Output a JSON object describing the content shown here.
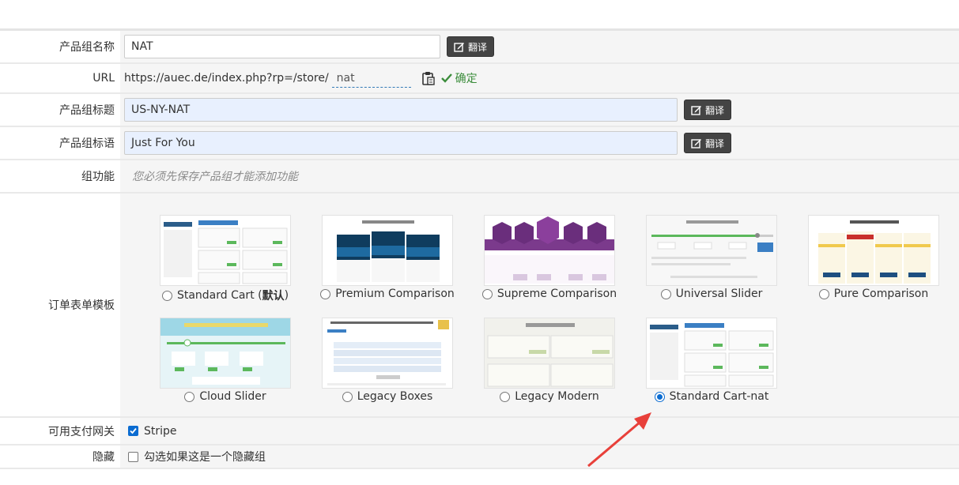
{
  "form": {
    "group_name": {
      "label": "产品组名称",
      "value": "NAT",
      "translate_label": "翻译"
    },
    "url": {
      "label": "URL",
      "prefix": "https://auec.de/index.php?rp=/store/",
      "slug": "nat",
      "confirm_label": "确定"
    },
    "group_headline": {
      "label": "产品组标题",
      "value": "US-NY-NAT",
      "translate_label": "翻译"
    },
    "group_tagline": {
      "label": "产品组标语",
      "value": "Just For You",
      "translate_label": "翻译"
    },
    "group_features": {
      "label": "组功能",
      "hint": "您必须先保存产品组才能添加功能"
    },
    "order_template": {
      "label": "订单表单模板",
      "templates": [
        {
          "name": "Standard Cart (",
          "name_bold": "默认",
          "name_end": ")",
          "selected": false
        },
        {
          "name": "Premium Comparison",
          "selected": false
        },
        {
          "name": "Supreme Comparison",
          "selected": false
        },
        {
          "name": "Universal Slider",
          "selected": false
        },
        {
          "name": "Pure Comparison",
          "selected": false
        },
        {
          "name": "Cloud Slider",
          "selected": false
        },
        {
          "name": "Legacy Boxes",
          "selected": false
        },
        {
          "name": "Legacy Modern",
          "selected": false
        },
        {
          "name": "Standard Cart-nat",
          "selected": true
        }
      ]
    },
    "payment_gateways": {
      "label": "可用支付网关",
      "option": "Stripe",
      "checked": true
    },
    "hidden": {
      "label": "隐藏",
      "option": "勾选如果这是一个隐藏组",
      "checked": false
    }
  },
  "colors": {
    "accent": "#0b6cd1",
    "translate_button": "#444444",
    "confirm": "#3c8d3c",
    "annotation_arrow": "#e8403a"
  },
  "icons": [
    "edit-icon",
    "clipboard-icon",
    "check-icon",
    "radio-icon",
    "checkbox-icon",
    "annotation-arrow"
  ]
}
